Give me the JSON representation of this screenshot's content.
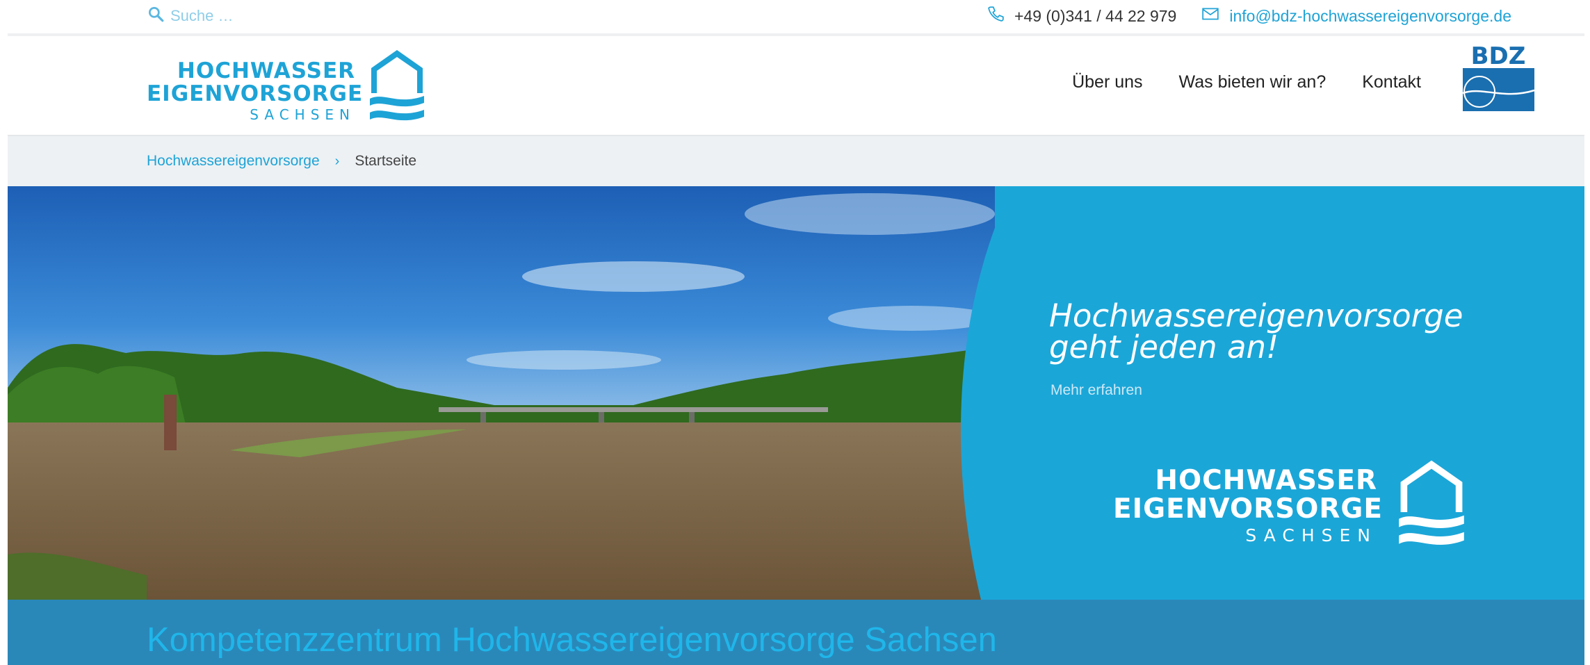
{
  "topbar": {
    "search_placeholder": "Suche …",
    "phone": "+49 (0)341 / 44 22 979",
    "email": "info@bdz-hochwassereigenvorsorge.de"
  },
  "logo": {
    "line1": "HOCHWASSER",
    "line2": "EIGENVORSORGE",
    "line3": "SACHSEN"
  },
  "nav": {
    "items": [
      "Über uns",
      "Was bieten wir an?",
      "Kontakt"
    ]
  },
  "partner_logo": {
    "text": "BDZ"
  },
  "breadcrumb": {
    "home": "Hochwassereigenvorsorge",
    "separator": "›",
    "current": "Startseite"
  },
  "hero": {
    "headline_line1": "Hochwassereigenvorsorge",
    "headline_line2": "geht jeden an!",
    "link": "Mehr erfahren",
    "logo_line1": "HOCHWASSER",
    "logo_line2": "EIGENVORSORGE",
    "logo_line3": "SACHSEN"
  },
  "band": {
    "title": "Kompetenzzentrum Hochwassereigenvorsorge Sachsen"
  },
  "colors": {
    "brand_blue": "#1ea3d6",
    "hero_panel": "#1ba6d8",
    "band_bg": "#2a88b9",
    "band_text": "#1fb6ea",
    "bdz_blue": "#1a6fb0"
  },
  "icons": {
    "search": "search-icon",
    "phone": "phone-icon",
    "mail": "mail-icon"
  }
}
